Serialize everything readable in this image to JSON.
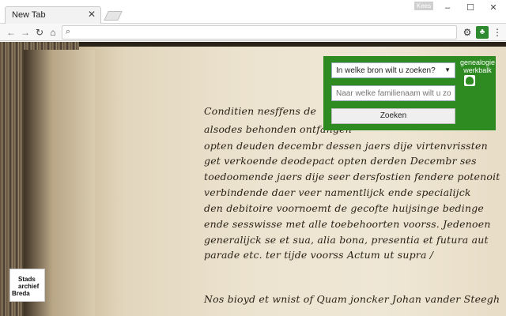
{
  "browser": {
    "tab": {
      "title": "New Tab"
    },
    "profile_label": "Kees",
    "omnibox": {
      "value": ""
    }
  },
  "icons": {
    "tab_close": "close-icon",
    "back": "arrow-left-icon",
    "forward": "arrow-right-icon",
    "reload": "reload-icon",
    "home": "home-icon",
    "search": "search-icon",
    "settings": "gear-icon",
    "extension": "tree-icon",
    "menu": "kebab-menu-icon"
  },
  "manuscript_lines": [
    "Conditien nesffens de",
    "alsodes behonden ontfangen",
    "opten deuden decembr dessen jaers dije virtenvrissten",
    "get verkoende deodepact opten derden Decembr ses",
    "toedoomende jaers dije seer dersfostien fendere potenoit",
    "verbindende daer veer namentlijck ende specialijck",
    "den debitoire voornoemt de gecofte huijsinge bedinge",
    "ende sesswisse met alle toebehoorten voorss. Jedenoen",
    "generalijck se et sua, alia bona, presentia et futura aut",
    "parade etc. ter tijde voorss Actum ut supra /",
    "Nos bioyd et wnist of Quam joncker Johan vander Steegh"
  ],
  "overlay": {
    "brand": "genealogie werkbalk",
    "source_select": "In welke bron wilt u zoeken?",
    "surname_placeholder": "Naar welke familienaam wilt u zoeken?",
    "search_button": "Zoeken",
    "color": "#2e8b22"
  },
  "archive_logo": {
    "line1": "Stads",
    "line2": "archief",
    "line3": "Breda"
  }
}
